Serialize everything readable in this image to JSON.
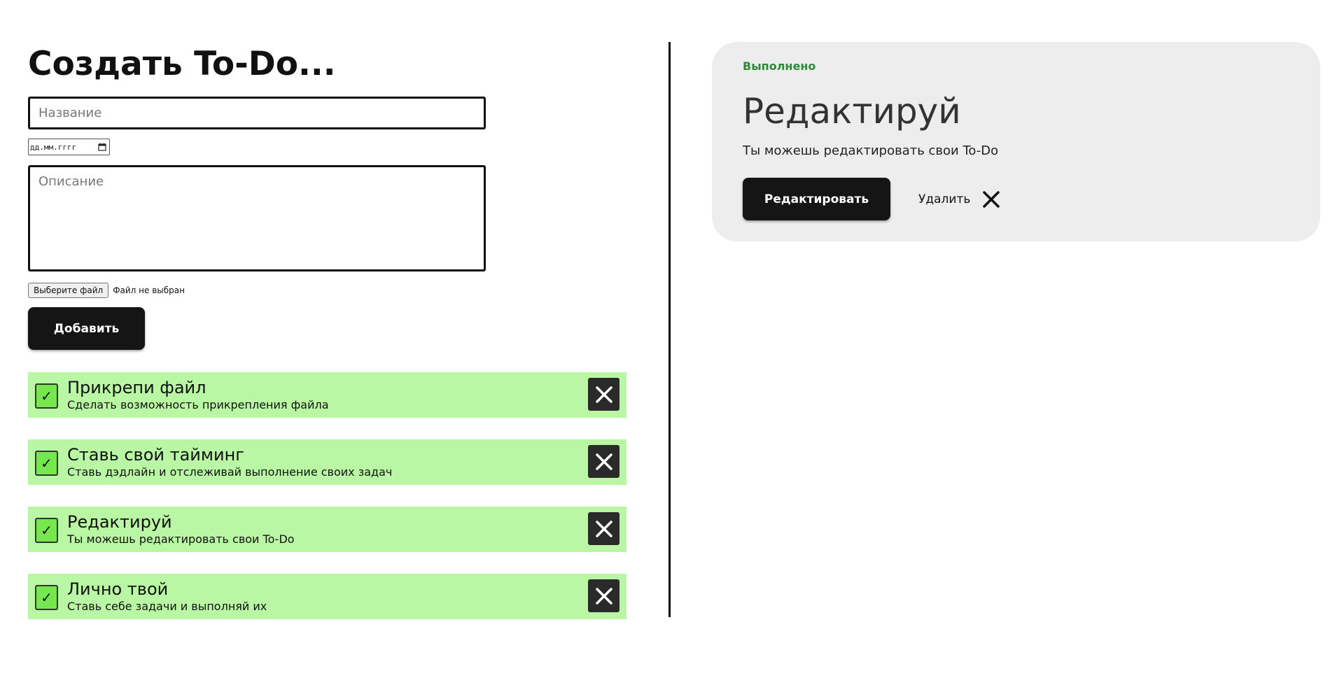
{
  "create_form": {
    "title": "Создать To-Do...",
    "name_placeholder": "Название",
    "date_placeholder": "дд.мм.гггг",
    "description_placeholder": "Описание",
    "file_button_label": "Выберите файл",
    "file_status": "Файл не выбран",
    "add_button_label": "Добавить"
  },
  "todos": [
    {
      "title": "Прикрепи файл",
      "description": "Сделать возможность прикрепления файла",
      "checked": true,
      "check_glyph": "✓"
    },
    {
      "title": "Ставь свой тайминг",
      "description": "Ставь дэдлайн и отслеживай выполнение своих задач",
      "checked": true,
      "check_glyph": "✓"
    },
    {
      "title": "Редактируй",
      "description": "Ты можешь редактировать свои To-Do",
      "checked": true,
      "check_glyph": "✓"
    },
    {
      "title": "Лично твой",
      "description": "Ставь себе задачи и выполняй их",
      "checked": true,
      "check_glyph": "✓"
    }
  ],
  "detail": {
    "status": "Выполнено",
    "title": "Редактируй",
    "description": "Ты можешь редактировать свои To-Do",
    "edit_button_label": "Редактировать",
    "delete_label": "Удалить"
  },
  "icons": {
    "todo_delete": "close-icon",
    "detail_delete": "close-icon",
    "date_picker": "calendar-icon",
    "todo_check": "checkmark-icon"
  },
  "colors": {
    "todo_background": "#b9f7a4",
    "checkbox_fill": "#76e84d",
    "status_green": "#2e8b3a",
    "button_dark": "#151515",
    "card_background": "#ededed"
  }
}
